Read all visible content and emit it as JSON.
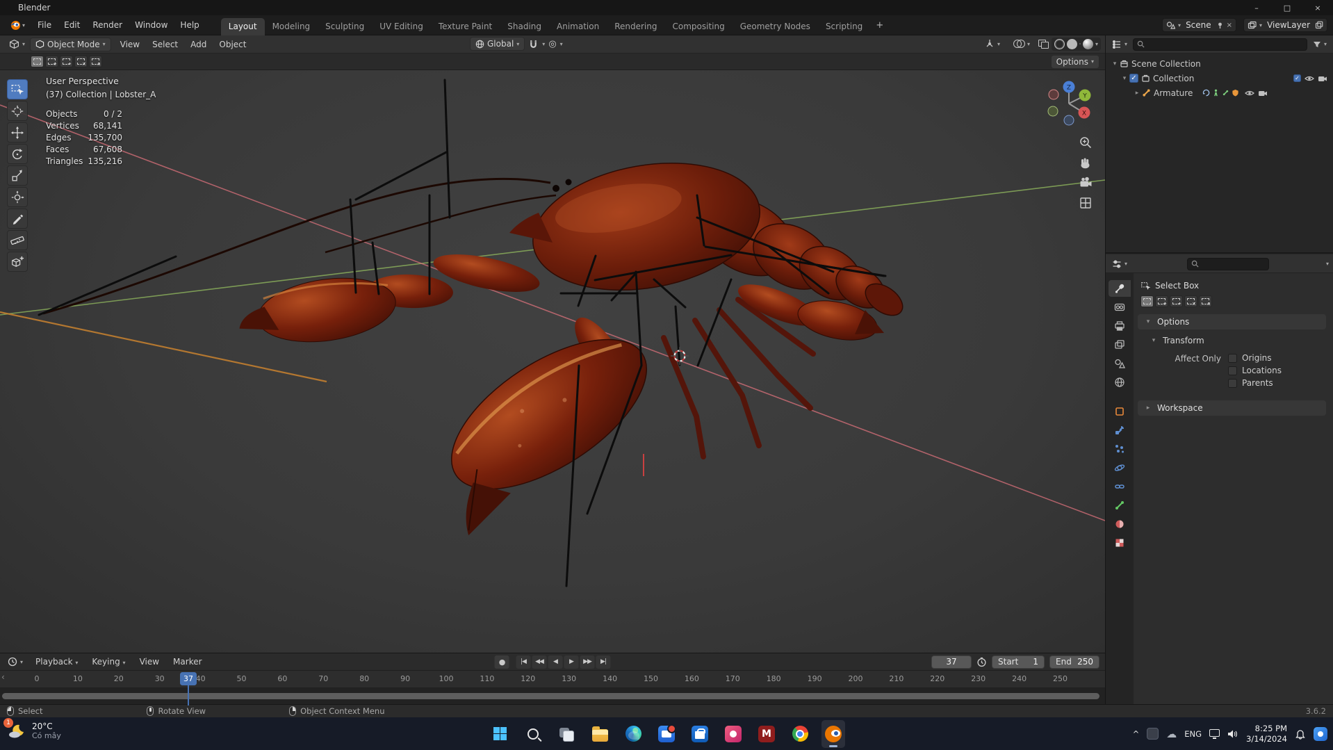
{
  "window": {
    "title": "Blender"
  },
  "icons": {
    "chevron": "▾",
    "expand": "▸",
    "close": "×",
    "minimize": "–",
    "maximize": "□",
    "plus": "+",
    "check": "✓",
    "record": "●",
    "jump_start": "|◀",
    "prev_key": "◀◀",
    "play_back": "◀",
    "play": "▶",
    "next_key": "▶▶",
    "jump_end": "▶|",
    "caret_up": "^",
    "cloud": "☁",
    "m_logo": "M",
    "prop_edit": "◎",
    "scroll_left": "‹"
  },
  "topbar": {
    "menus": [
      "File",
      "Edit",
      "Render",
      "Window",
      "Help"
    ],
    "tabs": [
      "Layout",
      "Modeling",
      "Sculpting",
      "UV Editing",
      "Texture Paint",
      "Shading",
      "Animation",
      "Rendering",
      "Compositing",
      "Geometry Nodes",
      "Scripting"
    ],
    "active_tab_index": 0,
    "scene_label": "Scene",
    "view_layer_label": "ViewLayer"
  },
  "viewport": {
    "header": {
      "mode": "Object Mode",
      "menus": [
        "View",
        "Select",
        "Add",
        "Object"
      ],
      "orientation": "Global"
    },
    "tool_settings": {
      "options_label": "Options",
      "select_mode_marks": [
        "",
        "+",
        "−",
        "×",
        "∩"
      ]
    },
    "overlay": {
      "perspective": "User Perspective",
      "context": "(37) Collection | Lobster_A",
      "stats": [
        {
          "label": "Objects",
          "value": "0 / 2"
        },
        {
          "label": "Vertices",
          "value": "68,141"
        },
        {
          "label": "Edges",
          "value": "135,700"
        },
        {
          "label": "Faces",
          "value": "67,608"
        },
        {
          "label": "Triangles",
          "value": "135,216"
        }
      ]
    },
    "gizmo_axes": {
      "x": "X",
      "y": "Y",
      "z": "Z"
    }
  },
  "outliner": {
    "scene_collection": "Scene Collection",
    "collection": "Collection",
    "armature": "Armature"
  },
  "properties": {
    "tool_name": "Select Box",
    "options_header": "Options",
    "transform_header": "Transform",
    "affect_only_label": "Affect Only",
    "affect_items": [
      "Origins",
      "Locations",
      "Parents"
    ],
    "workspace_header": "Workspace"
  },
  "timeline": {
    "menus": [
      "Playback",
      "Keying",
      "View",
      "Marker"
    ],
    "current_frame": "37",
    "start_label": "Start",
    "start_value": "1",
    "end_label": "End",
    "end_value": "250",
    "ruler": [
      "0",
      "10",
      "20",
      "30",
      "40",
      "50",
      "60",
      "70",
      "80",
      "90",
      "100",
      "110",
      "120",
      "130",
      "140",
      "150",
      "160",
      "170",
      "180",
      "190",
      "200",
      "210",
      "220",
      "230",
      "240",
      "250"
    ]
  },
  "statusbar": {
    "items": [
      "Select",
      "Rotate View",
      "Object Context Menu"
    ],
    "version": "3.6.2"
  },
  "taskbar": {
    "weather_badge": "1",
    "weather_temp": "20°C",
    "weather_desc": "Có mây",
    "language": "ENG",
    "time": "8:25 PM",
    "date": "3/14/2024"
  },
  "colors": {
    "accent": "#4772b3",
    "blender_orange": "#ea7600"
  }
}
